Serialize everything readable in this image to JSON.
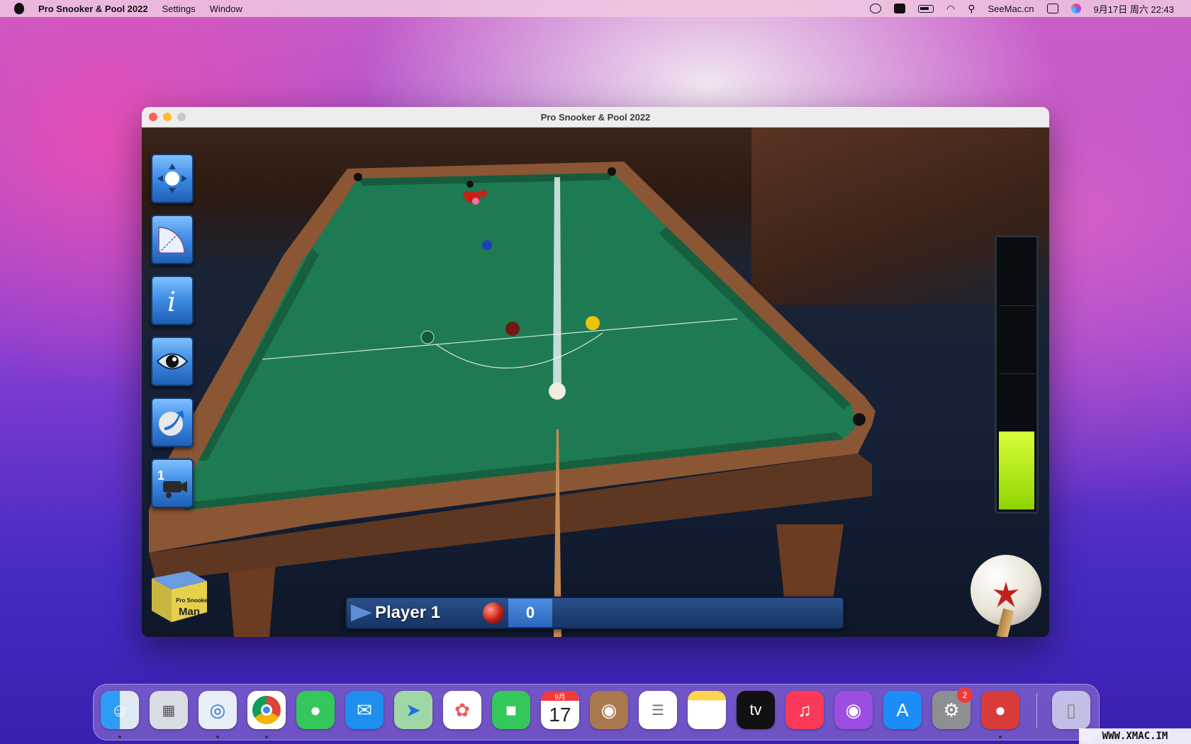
{
  "menubar": {
    "app_name": "Pro Snooker & Pool 2022",
    "menus": [
      "Settings",
      "Window"
    ],
    "status_site": "SeeMac.cn",
    "datetime": "9月17日 周六  22:43"
  },
  "window": {
    "title": "Pro Snooker & Pool 2022"
  },
  "game": {
    "player_name": "Player 1",
    "score": "0",
    "power_level_percent": 29,
    "toolbar": [
      "move-cue-ball",
      "aim-angle",
      "info",
      "view-eye",
      "spin",
      "camera-1"
    ],
    "camera_number": "1",
    "chalk_label_top": "Pro Snooker",
    "chalk_label_bottom": "Man"
  },
  "dock": {
    "calendar_month": "9月",
    "calendar_day": "17",
    "tv_label": "tv",
    "badge_count": "2"
  },
  "watermark": "WWW.XMAC.IM",
  "colors": {
    "felt": "#1e7a52",
    "power_fill": "#b2ec1a",
    "score_bar": "#1f4c8c"
  }
}
